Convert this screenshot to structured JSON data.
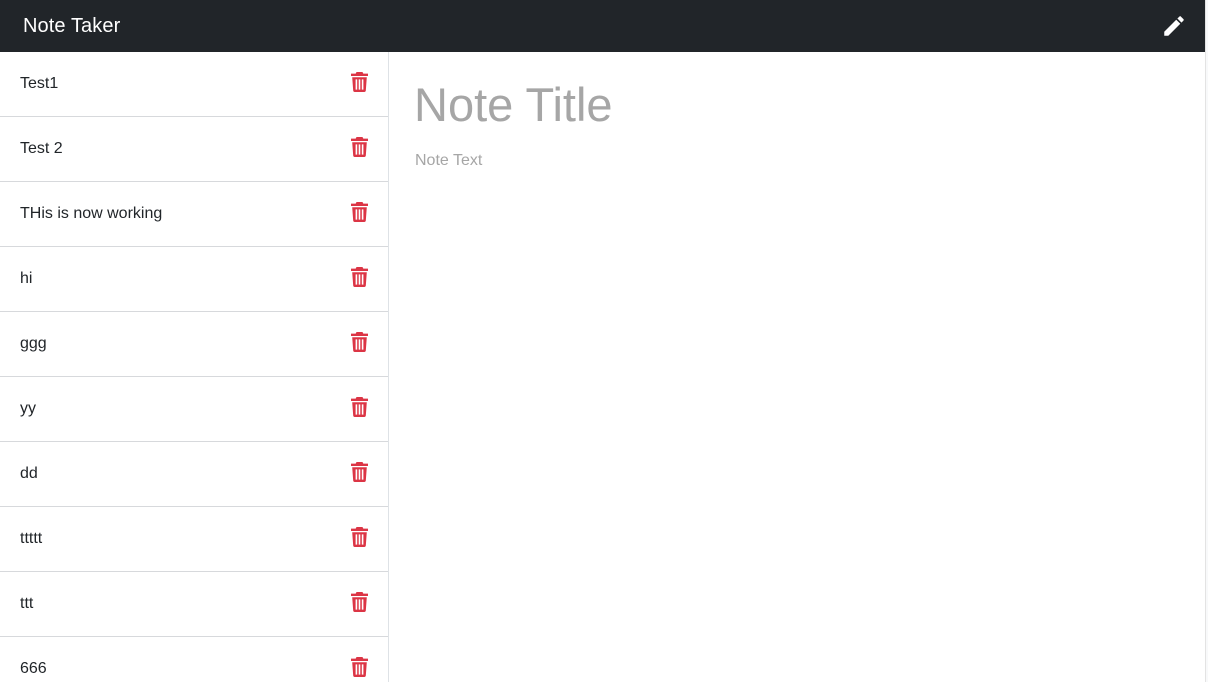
{
  "navbar": {
    "brand": "Note Taker",
    "edit_icon": "pencil-icon"
  },
  "notes": [
    {
      "title": "Test1",
      "delete_icon": "trash-icon"
    },
    {
      "title": "Test 2",
      "delete_icon": "trash-icon"
    },
    {
      "title": "THis is now working",
      "delete_icon": "trash-icon"
    },
    {
      "title": "hi",
      "delete_icon": "trash-icon"
    },
    {
      "title": "ggg",
      "delete_icon": "trash-icon"
    },
    {
      "title": "yy",
      "delete_icon": "trash-icon"
    },
    {
      "title": "dd",
      "delete_icon": "trash-icon"
    },
    {
      "title": "ttttt",
      "delete_icon": "trash-icon"
    },
    {
      "title": "ttt",
      "delete_icon": "trash-icon"
    },
    {
      "title": "666",
      "delete_icon": "trash-icon"
    }
  ],
  "editor": {
    "title_value": "",
    "title_placeholder": "Note Title",
    "text_value": "",
    "text_placeholder": "Note Text"
  },
  "colors": {
    "navbar_bg": "#212529",
    "delete_red": "#dc3545",
    "placeholder_gray": "#a6a6a6"
  }
}
